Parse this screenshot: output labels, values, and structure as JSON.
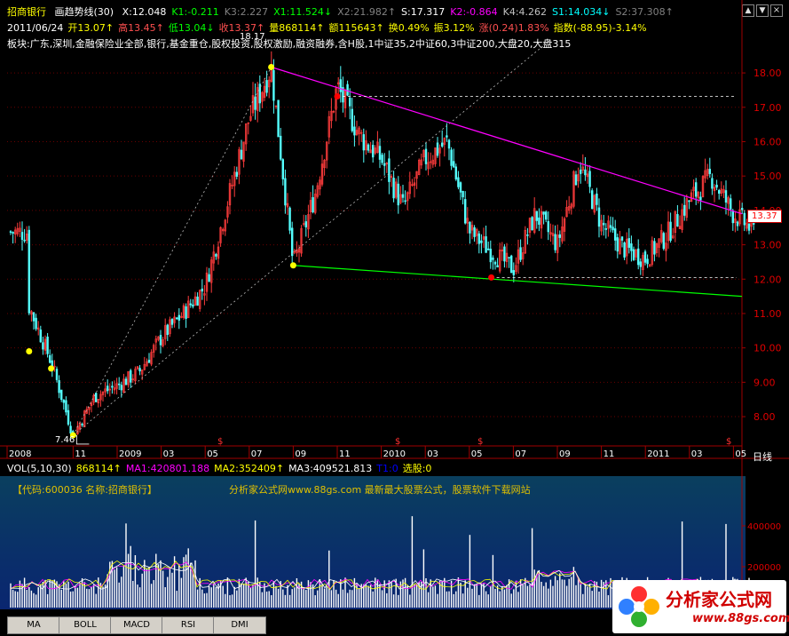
{
  "header": {
    "stock_name": "招商银行",
    "indicator": "画趋势线(30)",
    "line1": [
      {
        "t": "X:12.048",
        "c": "#ffffff"
      },
      {
        "t": "K1:-0.211",
        "c": "#00ff00"
      },
      {
        "t": "K3:2.227",
        "c": "#808080"
      },
      {
        "t": "X1:11.524↓",
        "c": "#00ff00"
      },
      {
        "t": "X2:21.982↑",
        "c": "#808080"
      },
      {
        "t": "S:17.317",
        "c": "#ffffff"
      },
      {
        "t": "K2:-0.864",
        "c": "#ff00ff"
      },
      {
        "t": "K4:4.262",
        "c": "#c0c0c0"
      },
      {
        "t": "S1:14.034↓",
        "c": "#00ffff"
      },
      {
        "t": "S2:37.308↑",
        "c": "#808080"
      }
    ],
    "line2": [
      {
        "t": "2011/06/24",
        "c": "#ffffff"
      },
      {
        "t": "开13.07↑",
        "c": "#ffff00"
      },
      {
        "t": "高13.45↑",
        "c": "#ff5050"
      },
      {
        "t": "低13.04↓",
        "c": "#00ff00"
      },
      {
        "t": "收13.37↑",
        "c": "#ff5050"
      },
      {
        "t": "量868114↑",
        "c": "#ffff00"
      },
      {
        "t": "额115643↑",
        "c": "#ffff00"
      },
      {
        "t": "换0.49%",
        "c": "#ffff00"
      },
      {
        "t": "振3.12%",
        "c": "#ffff00"
      },
      {
        "t": "涨(0.24)1.83%",
        "c": "#ff5050"
      },
      {
        "t": "指数(-88.95)-3.14%",
        "c": "#ffff00"
      }
    ],
    "line3": "板块:广东,深圳,金融保险业全部,银行,基金重仓,股权投资,股权激励,融资融券,含H股,1中证35,2中证60,3中证200,大盘20,大盘315"
  },
  "price_labels": {
    "high": "18.17",
    "low": "7.46",
    "current": "13.37",
    "period": "日线"
  },
  "volume_header": [
    {
      "t": "VOL(5,10,30)",
      "c": "#ffffff"
    },
    {
      "t": "868114↑",
      "c": "#ffff00"
    },
    {
      "t": "MA1:420801.188",
      "c": "#ff00ff"
    },
    {
      "t": "MA2:352409↑",
      "c": "#ffff00"
    },
    {
      "t": "MA3:409521.813",
      "c": "#ffffff"
    },
    {
      "t": "T1:0",
      "c": "#0000ff"
    },
    {
      "t": "选股:0",
      "c": "#ffff00"
    }
  ],
  "banner": {
    "code": "【代码:600036 名称:招商银行】",
    "site": "分析家公式网www.88gs.com 最新最大股票公式，股票软件下载网站"
  },
  "logo": {
    "title": "分析家公式网",
    "url": "www.88gs.com"
  },
  "tabs": [
    "MA",
    "BOLL",
    "MACD",
    "RSI",
    "DMI"
  ],
  "icons": [
    "close-icon",
    "up-arrow-icon",
    "down-arrow-icon"
  ],
  "colors": {
    "up": "#ff3c3c",
    "down": "#54ffff",
    "trend_top": "#ff00ff",
    "trend_bottom": "#00ff00",
    "axis": "#a00000"
  },
  "chart_data": [
    {
      "type": "candlestick",
      "title": "招商银行 日线",
      "y_ticks": [
        8.0,
        9.0,
        10.0,
        11.0,
        12.0,
        13.0,
        14.0,
        15.0,
        16.0,
        17.0,
        18.0
      ],
      "ylim": [
        7.2,
        18.7
      ],
      "x_labels": [
        "2008",
        "11",
        "2009",
        "03",
        "05",
        "07",
        "09",
        "11",
        "2010",
        "03",
        "05",
        "07",
        "09",
        "11",
        "2011",
        "03",
        "05"
      ],
      "close_path": [
        [
          "2008-09",
          11.2
        ],
        [
          "2008-10",
          9.6
        ],
        [
          "2008-11",
          7.46
        ],
        [
          "2008-12",
          8.6
        ],
        [
          "2009-01",
          8.9
        ],
        [
          "2009-02",
          9.3
        ],
        [
          "2009-03",
          10.3
        ],
        [
          "2009-04",
          11.0
        ],
        [
          "2009-05",
          11.8
        ],
        [
          "2009-06",
          14.2
        ],
        [
          "2009-07",
          16.7
        ],
        [
          "2009-08",
          18.17
        ],
        [
          "2009-09",
          12.4
        ],
        [
          "2009-10",
          14.5
        ],
        [
          "2009-11",
          17.6
        ],
        [
          "2009-12",
          16.2
        ],
        [
          "2010-01",
          15.5
        ],
        [
          "2010-02",
          14.1
        ],
        [
          "2010-03",
          15.5
        ],
        [
          "2010-04",
          16.0
        ],
        [
          "2010-05",
          13.4
        ],
        [
          "2010-06",
          12.8
        ],
        [
          "2010-07",
          12.3
        ],
        [
          "2010-08",
          13.9
        ],
        [
          "2010-09",
          13.0
        ],
        [
          "2010-10",
          15.4
        ],
        [
          "2010-11",
          13.6
        ],
        [
          "2010-12",
          12.9
        ],
        [
          "2011-01",
          12.6
        ],
        [
          "2011-02",
          13.3
        ],
        [
          "2011-03",
          14.3
        ],
        [
          "2011-04",
          15.0
        ],
        [
          "2011-05",
          13.9
        ],
        [
          "2011-06",
          13.37
        ]
      ],
      "marks": [
        {
          "date": "2008-09",
          "value": 9.9,
          "color": "#ffff00"
        },
        {
          "date": "2008-10",
          "value": 9.4,
          "color": "#ffff00"
        },
        {
          "date": "2008-11",
          "value": 7.46,
          "color": "#ffff00"
        },
        {
          "date": "2009-08",
          "value": 18.17,
          "color": "#ffff00"
        },
        {
          "date": "2009-09",
          "value": 12.4,
          "color": "#ffff00"
        },
        {
          "date": "2009-11",
          "value": 17.317,
          "color": "#ff0000"
        },
        {
          "date": "2010-06",
          "value": 12.048,
          "color": "#ff0000"
        }
      ]
    },
    {
      "type": "bar",
      "title": "VOL(5,10,30)",
      "y_ticks": [
        200000,
        400000
      ],
      "ylim": [
        0,
        600000
      ]
    }
  ]
}
